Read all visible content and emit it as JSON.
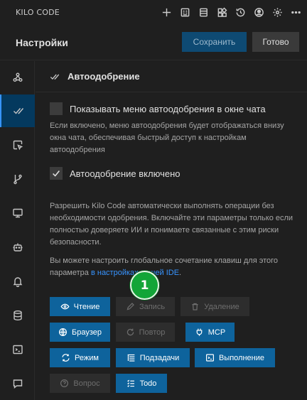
{
  "app": {
    "title": "KILO CODE"
  },
  "titlebar_icons": [
    "plus-icon",
    "history-card-icon",
    "list-icon",
    "marketplace-icon",
    "history-icon",
    "account-icon",
    "settings-icon",
    "more-icon"
  ],
  "header": {
    "title": "Настройки",
    "save_label": "Сохранить",
    "done_label": "Готово"
  },
  "sidebar": {
    "items": [
      {
        "name": "providers",
        "icon": "webhook-icon",
        "active": false
      },
      {
        "name": "auto-approve",
        "icon": "check-all-icon",
        "active": true
      },
      {
        "name": "browser",
        "icon": "browser-cursor-icon",
        "active": false
      },
      {
        "name": "checkpoints",
        "icon": "git-branch-icon",
        "active": false
      },
      {
        "name": "display",
        "icon": "monitor-icon",
        "active": false
      },
      {
        "name": "experimental",
        "icon": "bot-icon",
        "active": false
      },
      {
        "name": "notifications",
        "icon": "bell-icon",
        "active": false
      },
      {
        "name": "context",
        "icon": "database-icon",
        "active": false
      },
      {
        "name": "terminal",
        "icon": "terminal-icon",
        "active": false
      },
      {
        "name": "prompts",
        "icon": "chat-icon",
        "active": false
      }
    ]
  },
  "section": {
    "title": "Автоодобрение",
    "show_menu": {
      "label": "Показывать меню автоодобрения в окне чата",
      "checked": false,
      "description": "Если включено, меню автоодобрения будет отображаться внизу окна чата, обеспечивая быстрый доступ к настройкам автоодобрения"
    },
    "enabled": {
      "label": "Автоодобрение включено",
      "checked": true
    },
    "warning": "Разрешить Kilo Code автоматически выполнять операции без необходимости одобрения. Включайте эти параметры только если полностью доверяете ИИ и понимаете связанные с этим риски безопасности.",
    "shortcut_text": "Вы можете настроить глобальное сочетание клавиш для этого параметра ",
    "shortcut_link": "в настройках вашей IDE",
    "shortcut_end": "."
  },
  "toggles": [
    {
      "label": "Чтение",
      "icon": "eye-icon",
      "state": "on"
    },
    {
      "label": "Запись",
      "icon": "pencil-icon",
      "state": "off"
    },
    {
      "label": "Удаление",
      "icon": "trash-icon",
      "state": "off"
    },
    {
      "label": "Браузер",
      "icon": "globe-icon",
      "state": "on"
    },
    {
      "label": "Повтор",
      "icon": "refresh-icon",
      "state": "off"
    },
    {
      "label": "MCP",
      "icon": "plug-icon",
      "state": "on"
    },
    {
      "label": "Режим",
      "icon": "sync-icon",
      "state": "on"
    },
    {
      "label": "Подзадачи",
      "icon": "list-tree-icon",
      "state": "on"
    },
    {
      "label": "Выполнение",
      "icon": "terminal-icon",
      "state": "on"
    },
    {
      "label": "Вопрос",
      "icon": "question-icon",
      "state": "off"
    },
    {
      "label": "Todo",
      "icon": "checklist-icon",
      "state": "on"
    }
  ],
  "marker": {
    "label": "1"
  },
  "colors": {
    "accent": "#0e639c",
    "save_bg": "#0e4a73",
    "active_side": "#04395e",
    "marker": "#13a538"
  }
}
